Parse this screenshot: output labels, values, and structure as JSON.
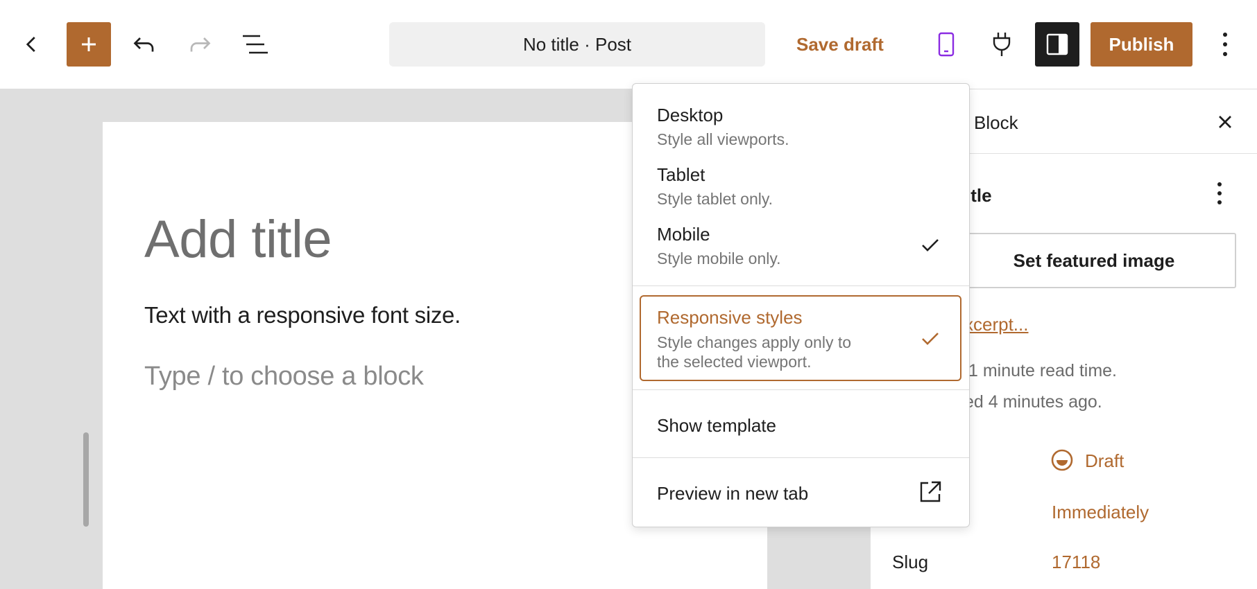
{
  "colors": {
    "accent": "#b0692f",
    "accent_text": "#b0692f",
    "mobile_icon": "#8a2be2",
    "dark": "#1e1e1e"
  },
  "toolbar": {
    "back_icon": "chevron-left-icon",
    "add_icon": "plus-icon",
    "undo_icon": "undo-icon",
    "redo_icon": "redo-icon",
    "list_view_icon": "list-view-icon",
    "document_title": "No title · Post",
    "save_draft_label": "Save draft",
    "device_preview_icon": "mobile-icon",
    "plugins_icon": "plug-icon",
    "settings_icon": "sidebar-toggle-icon",
    "publish_label": "Publish",
    "options_icon": "more-vertical-icon"
  },
  "editor": {
    "title_placeholder": "Add title",
    "paragraph_text": "Text with a responsive font size.",
    "block_placeholder": "Type / to choose a block"
  },
  "sidebar": {
    "tab_block": "Block",
    "close_icon": "close-icon",
    "post_heading_fragment": "itle",
    "featured_image_button": "Set featured image",
    "excerpt_link_fragment": "xcerpt...",
    "read_time_fragment": "1 minute read time.",
    "saved_fragment": "ed 4 minutes ago.",
    "status_value": "Draft",
    "publish_value": "Immediately",
    "slug_label": "Slug",
    "slug_value": "17118"
  },
  "menu": {
    "viewports": [
      {
        "label": "Desktop",
        "description": "Style all viewports.",
        "checked": false
      },
      {
        "label": "Tablet",
        "description": "Style tablet only.",
        "checked": false
      },
      {
        "label": "Mobile",
        "description": "Style mobile only.",
        "checked": true
      }
    ],
    "responsive": {
      "label": "Responsive styles",
      "description_line1": "Style changes apply only to",
      "description_line2": "the selected viewport.",
      "checked": true
    },
    "show_template": "Show template",
    "preview_new_tab": "Preview in new tab",
    "external_icon": "external-link-icon"
  }
}
